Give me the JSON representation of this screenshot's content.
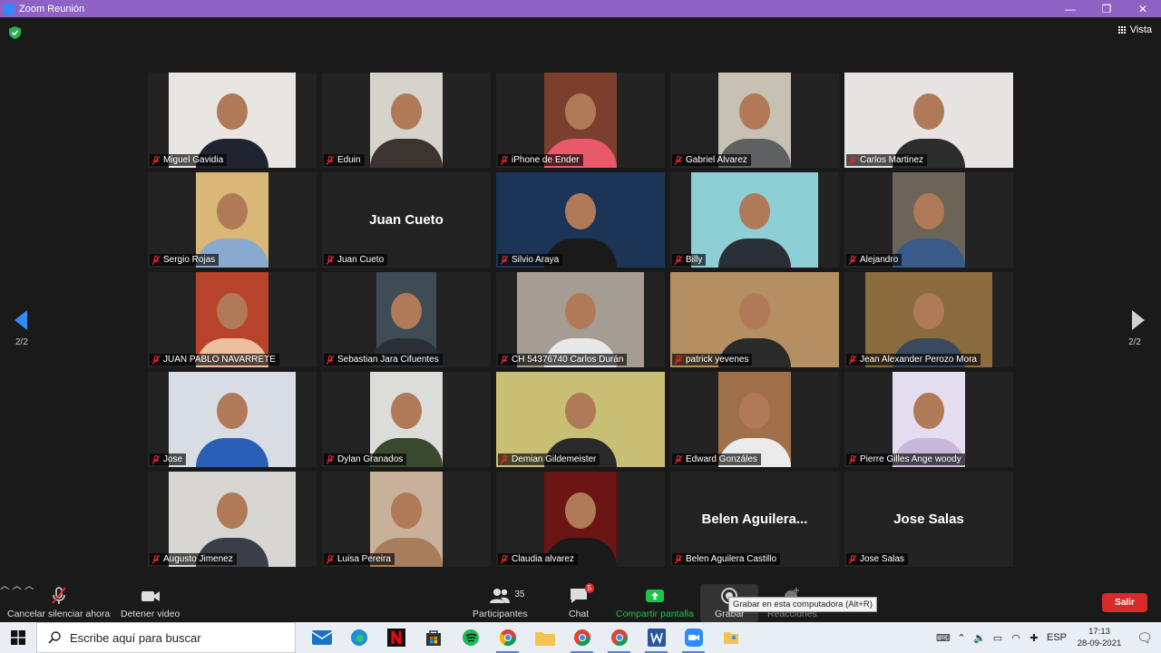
{
  "window": {
    "title": "Zoom Reunión",
    "min": "—",
    "max": "❐",
    "close": "✕"
  },
  "header": {
    "view_label": "Vista"
  },
  "pagination": {
    "left": "2/2",
    "right": "2/2"
  },
  "participants": [
    {
      "name": "Miguel Gavidia",
      "video": true,
      "muted": true,
      "bg": "#e9e5e2",
      "shirt": "#1f2430",
      "w": 140
    },
    {
      "name": "Eduin",
      "video": true,
      "muted": true,
      "bg": "#d6d2cc",
      "shirt": "#3a3530",
      "w": 80
    },
    {
      "name": "iPhone de Ender",
      "video": true,
      "muted": true,
      "bg": "#7a3f2d",
      "shirt": "#e85a6a",
      "w": 80
    },
    {
      "name": "Gabriel Alvarez",
      "video": true,
      "muted": true,
      "bg": "#c7c1b3",
      "shirt": "#5e6062",
      "w": 80
    },
    {
      "name": "Carlos Martinez",
      "video": true,
      "muted": true,
      "bg": "#e6e3e2",
      "shirt": "#2c2c2c",
      "w": 186
    },
    {
      "name": "Sergio Rojas",
      "video": true,
      "muted": true,
      "bg": "#d9b776",
      "shirt": "#8aa9cf",
      "w": 80
    },
    {
      "name": "Juan Cueto",
      "video": false,
      "muted": true,
      "big": "Juan Cueto"
    },
    {
      "name": "Silvio Araya",
      "video": true,
      "muted": true,
      "bg": "#1c3557",
      "shirt": "#1a1a1a",
      "w": 186
    },
    {
      "name": "Billy",
      "video": true,
      "muted": true,
      "bg": "#8ecfd6",
      "shirt": "#2b2f36",
      "w": 140
    },
    {
      "name": "Alejandro",
      "video": true,
      "muted": true,
      "bg": "#6b6459",
      "shirt": "#3a5a8a",
      "w": 80
    },
    {
      "name": "JUAN PABLO  NAVARRETE",
      "video": true,
      "muted": true,
      "bg": "#b7432a",
      "shirt": "#efc0a0",
      "w": 80
    },
    {
      "name": "Sebastian Jara Cifuentes",
      "video": true,
      "muted": true,
      "bg": "#3f4b55",
      "shirt": "#2a3036",
      "w": 66
    },
    {
      "name": "CH 54376740 Carlos Durán",
      "video": true,
      "muted": true,
      "bg": "#a59d93",
      "shirt": "#e8e8e8",
      "w": 140
    },
    {
      "name": "patrick yevenes",
      "video": true,
      "muted": true,
      "bg": "#b38f62",
      "shirt": "#2a2a2a",
      "w": 186
    },
    {
      "name": "Jean Alexander Perozo Mora",
      "video": true,
      "muted": true,
      "bg": "#8b6c3e",
      "shirt": "#3a4a5e",
      "w": 140
    },
    {
      "name": "Jose",
      "video": true,
      "muted": true,
      "bg": "#d8dce3",
      "shirt": "#2a5fb8",
      "w": 140
    },
    {
      "name": "Dylan Granados",
      "video": true,
      "muted": true,
      "bg": "#dcdcd8",
      "shirt": "#3a4a30",
      "w": 80
    },
    {
      "name": "Demian Gildemeister",
      "video": true,
      "muted": true,
      "bg": "#c8bf74",
      "shirt": "#2a2a2a",
      "w": 186
    },
    {
      "name": "Edward Gonzáles",
      "video": true,
      "muted": true,
      "bg": "#a0704a",
      "shirt": "#eaeaea",
      "w": 80
    },
    {
      "name": "Pierre Gilles Ange woody",
      "video": true,
      "muted": true,
      "bg": "#e4dcef",
      "shirt": "#c9b7d9",
      "w": 80
    },
    {
      "name": "Augusto Jimenez",
      "video": true,
      "muted": true,
      "bg": "#d8d6d3",
      "shirt": "#3a3f45",
      "w": 140
    },
    {
      "name": "Luisa Pereira",
      "video": true,
      "muted": true,
      "bg": "#c8b19a",
      "shirt": "#a87d5c",
      "w": 80
    },
    {
      "name": "Claudia alvarez",
      "video": true,
      "muted": true,
      "bg": "#6b1515",
      "shirt": "#1a1a1a",
      "w": 80
    },
    {
      "name": "Belen Aguilera Castillo",
      "video": false,
      "muted": true,
      "big": "Belen  Aguilera..."
    },
    {
      "name": "Jose Salas",
      "video": false,
      "muted": true,
      "big": "Jose Salas"
    }
  ],
  "toolbar": {
    "unmute_label": "Cancelar silenciar ahora",
    "stop_video_label": "Detener video",
    "participants_label": "Participantes",
    "participants_count": "35",
    "chat_label": "Chat",
    "chat_badge": "5",
    "share_label": "Compartir pantalla",
    "record_label": "Grabar",
    "reactions_label": "Reacciones",
    "record_tooltip": "Grabar en esta computadora (Alt+R)",
    "leave_label": "Salir"
  },
  "taskbar": {
    "search_placeholder": "Escribe aquí para buscar",
    "language": "ESP",
    "time": "17:13",
    "date": "28-09-2021"
  },
  "colors": {
    "title_bar": "#8e62c4",
    "leave": "#d72a2a",
    "share": "#1fc24a",
    "muted_mic": "#e02828"
  }
}
